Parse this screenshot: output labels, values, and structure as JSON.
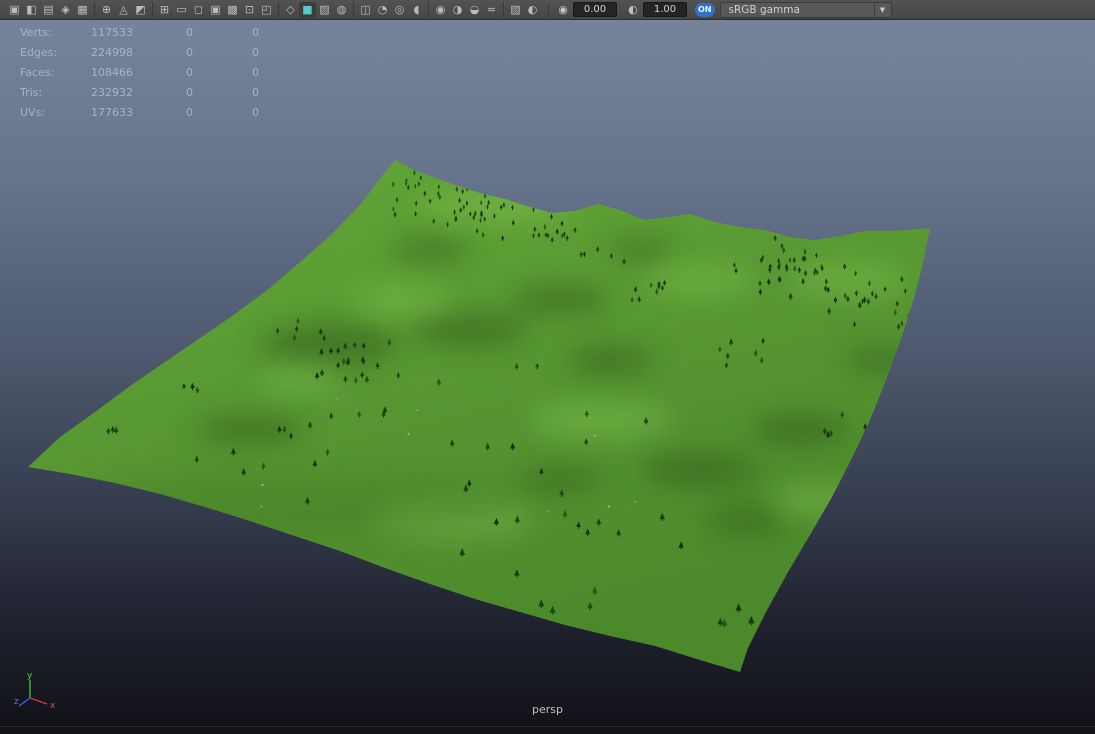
{
  "toolbar": {
    "groups": [
      {
        "name": "camera-tools",
        "items": [
          {
            "name": "select-camera-icon",
            "glyph": "▣"
          },
          {
            "name": "lock-camera-icon",
            "glyph": "◧"
          },
          {
            "name": "camera-attributes-icon",
            "glyph": "▤"
          },
          {
            "name": "bookmarks-icon",
            "glyph": "◈"
          },
          {
            "name": "image-plane-icon",
            "glyph": "▦"
          }
        ]
      },
      {
        "name": "view-tools",
        "items": [
          {
            "name": "pan-zoom-2d-icon",
            "glyph": "⊕"
          },
          {
            "name": "grease-pencil-icon",
            "glyph": "◬"
          },
          {
            "name": "snapshot-icon",
            "glyph": "◩"
          }
        ]
      },
      {
        "name": "gates",
        "items": [
          {
            "name": "grid-icon",
            "glyph": "⊞"
          },
          {
            "name": "film-gate-icon",
            "glyph": "▭"
          },
          {
            "name": "resolution-gate-icon",
            "glyph": "◻"
          },
          {
            "name": "gate-mask-icon",
            "glyph": "▣"
          },
          {
            "name": "field-chart-icon",
            "glyph": "▩"
          },
          {
            "name": "safe-action-icon",
            "glyph": "⊡"
          },
          {
            "name": "safe-title-icon",
            "glyph": "◰"
          }
        ]
      },
      {
        "name": "shading-modes",
        "items": [
          {
            "name": "wireframe-icon",
            "glyph": "◇"
          },
          {
            "name": "smooth-shade-all-icon",
            "glyph": "■",
            "active": true
          },
          {
            "name": "textured-icon",
            "glyph": "▨"
          },
          {
            "name": "use-default-material-icon",
            "glyph": "◍"
          }
        ]
      },
      {
        "name": "display-overrides",
        "items": [
          {
            "name": "wireframe-on-shaded-icon",
            "glyph": "◫"
          },
          {
            "name": "xray-icon",
            "glyph": "◔"
          },
          {
            "name": "xray-joints-icon",
            "glyph": "◎"
          },
          {
            "name": "isolate-select-icon",
            "glyph": "◖"
          }
        ]
      },
      {
        "name": "lighting-effects",
        "items": [
          {
            "name": "use-all-lights-icon",
            "glyph": "◉"
          },
          {
            "name": "shadows-icon",
            "glyph": "◑"
          },
          {
            "name": "screen-space-ao-icon",
            "glyph": "◒"
          },
          {
            "name": "motion-blur-icon",
            "glyph": "≈"
          }
        ]
      },
      {
        "name": "quality",
        "items": [
          {
            "name": "multisample-aa-icon",
            "glyph": "▧"
          },
          {
            "name": "depth-of-field-icon",
            "glyph": "◐"
          }
        ]
      }
    ],
    "exposure": {
      "icon_glyph": "◉",
      "value": "0.00"
    },
    "gamma": {
      "icon_glyph": "◐",
      "value": "1.00"
    },
    "on_label": "ON",
    "colorspace": "sRGB gamma",
    "chevron_down": "▼"
  },
  "hud": {
    "rows": [
      {
        "label": "Verts:",
        "total": "117533",
        "col2": "0",
        "col3": "0"
      },
      {
        "label": "Edges:",
        "total": "224998",
        "col2": "0",
        "col3": "0"
      },
      {
        "label": "Faces:",
        "total": "108466",
        "col2": "0",
        "col3": "0"
      },
      {
        "label": "Tris:",
        "total": "232932",
        "col2": "0",
        "col3": "0"
      },
      {
        "label": "UVs:",
        "total": "177633",
        "col2": "0",
        "col3": "0"
      }
    ]
  },
  "viewport": {
    "camera_label": "persp",
    "axis_labels": {
      "x": "x",
      "y": "y",
      "z": "z"
    }
  },
  "colors": {
    "terrain_green_light": "#63a738",
    "terrain_green_dark": "#4c892b",
    "sky_top": "#76839b",
    "sky_bottom": "#121218",
    "hud_text": "#a7b3c8",
    "active_icon": "#53cbca",
    "on_badge": "#2f74c0"
  }
}
